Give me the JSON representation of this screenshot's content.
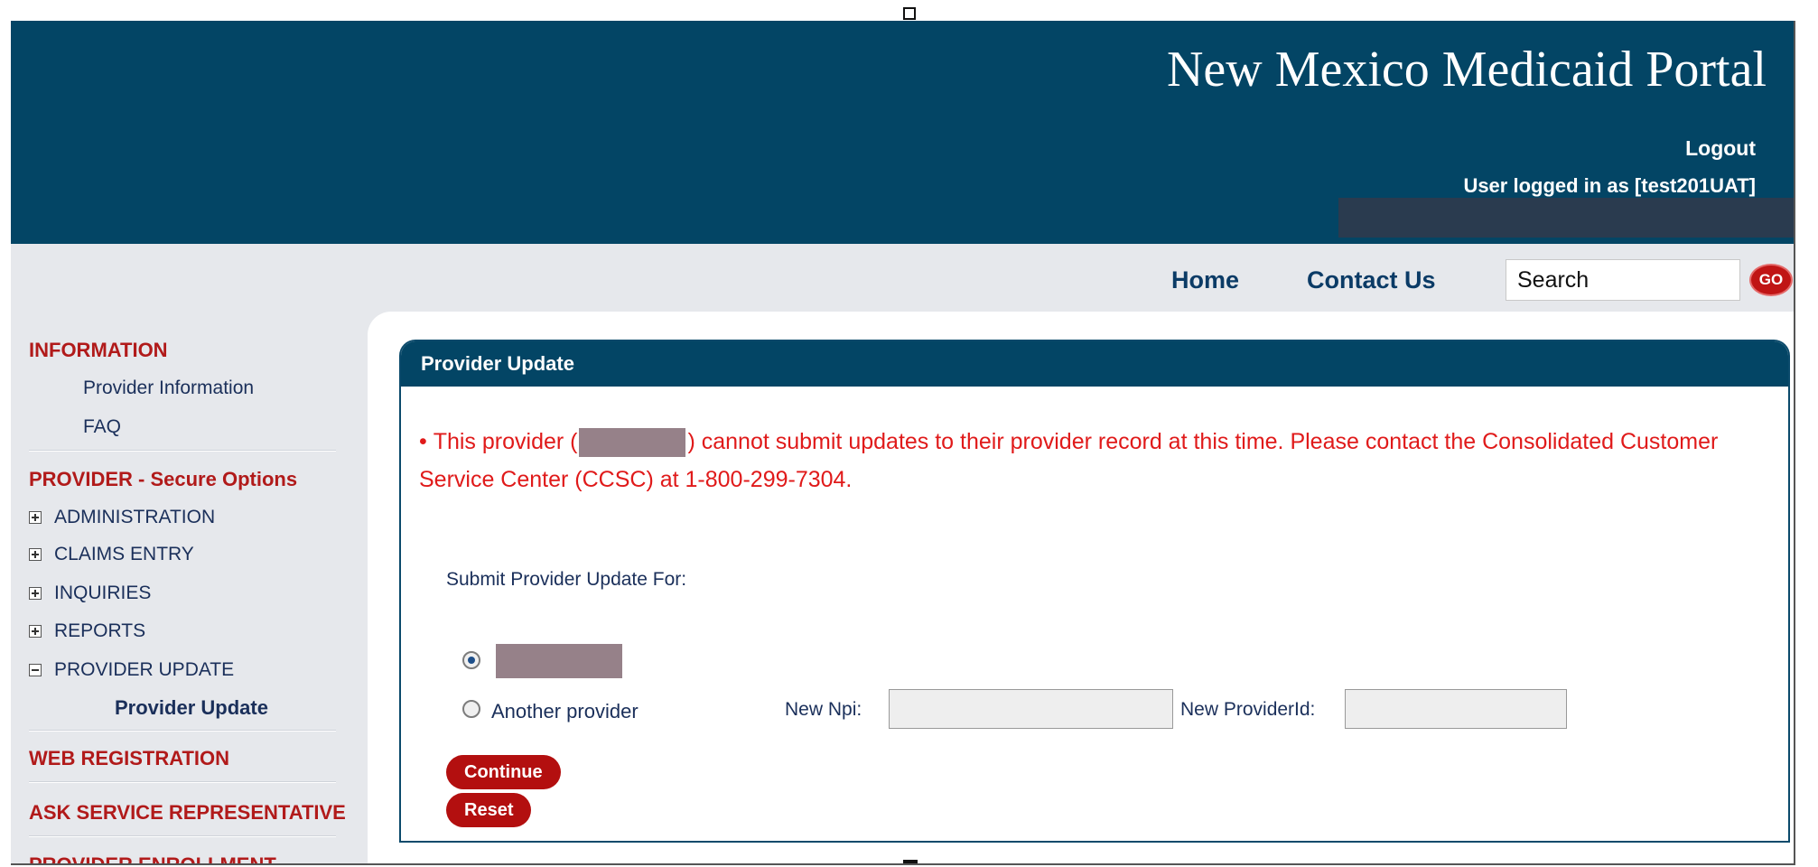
{
  "header": {
    "title": "New Mexico Medicaid Portal",
    "logout": "Logout",
    "logged_in_as": "User logged in as [test201UAT]"
  },
  "nav": {
    "home": "Home",
    "contact": "Contact Us",
    "search_value": "Search",
    "go": "GO"
  },
  "sidebar": {
    "information": "INFORMATION",
    "provider_information": "Provider Information",
    "faq": "FAQ",
    "provider_secure": "PROVIDER - Secure Options",
    "administration": "ADMINISTRATION",
    "claims_entry": "CLAIMS ENTRY",
    "inquiries": "INQUIRIES",
    "reports": "REPORTS",
    "provider_update": "PROVIDER UPDATE",
    "provider_update_active": "Provider Update",
    "web_registration": "WEB REGISTRATION",
    "ask_service": "ASK SERVICE REPRESENTATIVE",
    "provider_enrollment": "PROVIDER ENROLLMENT"
  },
  "panel": {
    "title": "Provider Update",
    "error_prefix": "This provider (",
    "error_suffix": ") cannot submit updates to their provider record at this time. Please contact the Consolidated Customer Service Center (CCSC) at 1-800-299-7304.",
    "submit_for": "Submit Provider Update For:",
    "another_provider": "Another provider",
    "new_npi_label": "New Npi:",
    "new_provider_id_label": "New ProviderId:",
    "continue": "Continue",
    "reset": "Reset"
  }
}
